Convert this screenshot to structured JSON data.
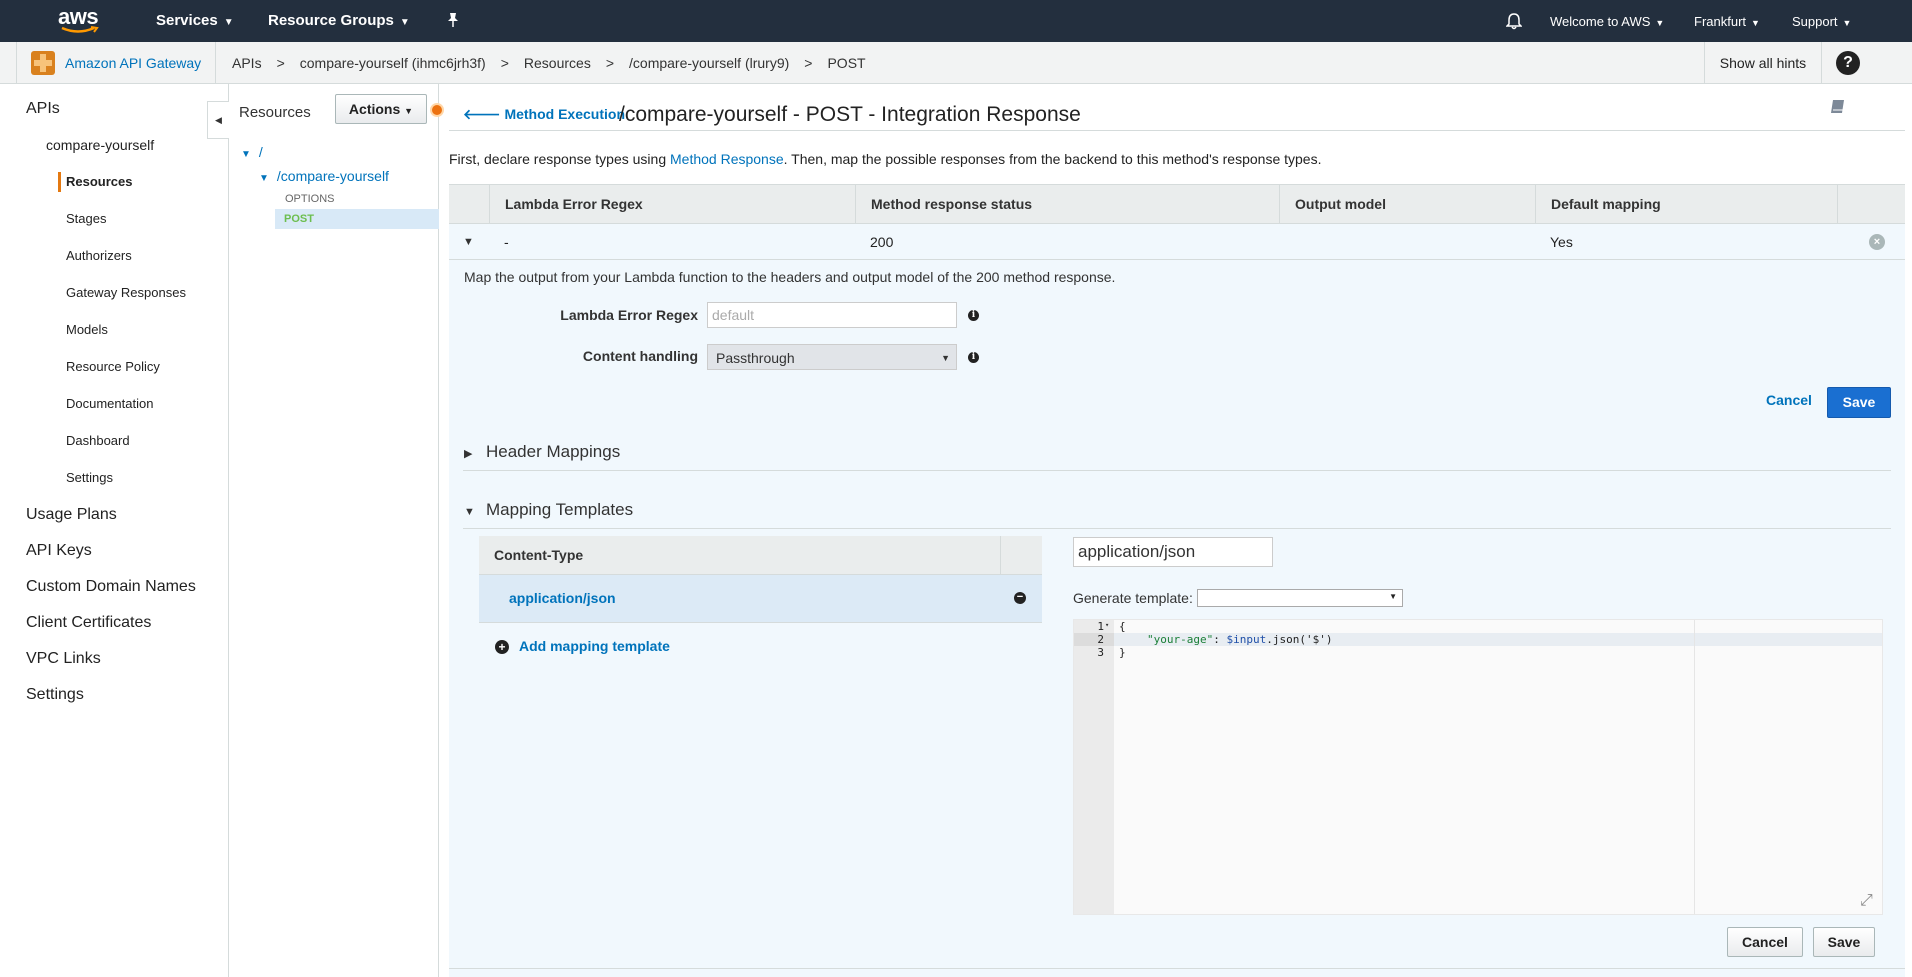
{
  "topnav": {
    "logo": "aws",
    "services": "Services",
    "resource_groups": "Resource Groups",
    "welcome": "Welcome to AWS",
    "region": "Frankfurt",
    "support": "Support"
  },
  "subbar": {
    "service_name": "Amazon API Gateway",
    "breadcrumbs": [
      "APIs",
      "compare-yourself (ihmc6jrh3f)",
      "Resources",
      "/compare-yourself (lrury9)",
      "POST"
    ],
    "crumb_sep": ">",
    "show_hints": "Show all hints",
    "help": "?"
  },
  "sidebar": {
    "apis": "APIs",
    "api_name": "compare-yourself",
    "items": [
      "Resources",
      "Stages",
      "Authorizers",
      "Gateway Responses",
      "Models",
      "Resource Policy",
      "Documentation",
      "Dashboard",
      "Settings"
    ],
    "bottom": [
      "Usage Plans",
      "API Keys",
      "Custom Domain Names",
      "Client Certificates",
      "VPC Links",
      "Settings"
    ]
  },
  "tree": {
    "title": "Resources",
    "actions": "Actions",
    "root": "/",
    "resource": "/compare-yourself",
    "methods": [
      "OPTIONS",
      "POST"
    ]
  },
  "main": {
    "back_link": "Method Execution",
    "title": "/compare-yourself - POST - Integration Response",
    "intro_before": "First, declare response types using ",
    "intro_link": "Method Response",
    "intro_after": ". Then, map the possible responses from the backend to this method's response types.",
    "table": {
      "headers": [
        "Lambda Error Regex",
        "Method response status",
        "Output model",
        "Default mapping"
      ],
      "row": [
        "-",
        "200",
        "",
        "Yes"
      ]
    },
    "detail": {
      "intro": "Map the output from your Lambda function to the headers and output model of the 200 method response.",
      "regex_label": "Lambda Error Regex",
      "regex_placeholder": "default",
      "content_handling_label": "Content handling",
      "content_handling_value": "Passthrough",
      "cancel": "Cancel",
      "save": "Save"
    },
    "header_mappings": "Header Mappings",
    "mapping_templates": "Mapping Templates",
    "templates": {
      "column": "Content-Type",
      "items": [
        "application/json"
      ],
      "add": "Add mapping template",
      "content_type_value": "application/json",
      "generate_label": "Generate template:",
      "generate_value": "",
      "code": {
        "line_numbers": [
          "1",
          "2",
          "3"
        ],
        "line1": "{",
        "line2_key": "\"your-age\"",
        "line2_colon": ": ",
        "line2_var": "$input",
        "line2_rest": ".json('$')",
        "line3": "}"
      },
      "cancel": "Cancel",
      "save": "Save"
    }
  },
  "colors": {
    "nav_bg": "#232f3e",
    "link": "#0073bb",
    "accent": "#e47911",
    "primary_button": "#1a6fd1",
    "post_method": "#6cbe4f"
  }
}
